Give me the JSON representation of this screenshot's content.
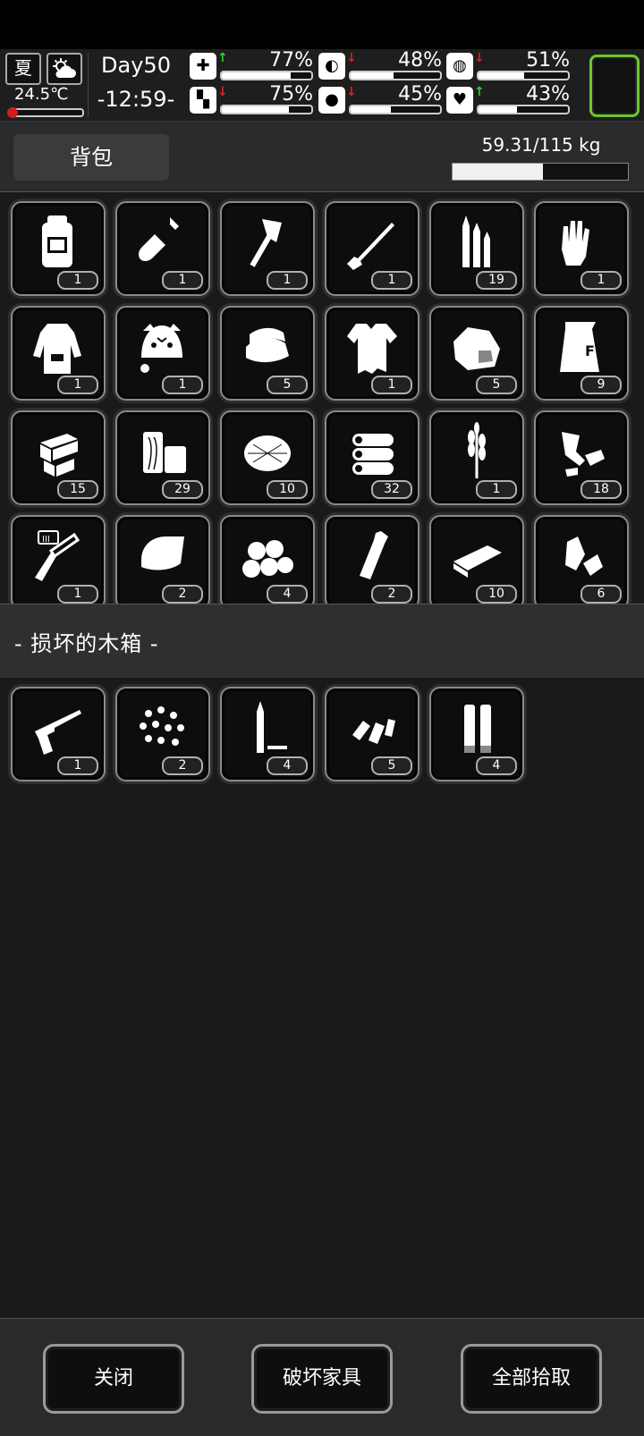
{
  "hud": {
    "season": "夏",
    "temperature": "24.5℃",
    "temperature_level": 0.05,
    "day": "Day50",
    "time": "-12:59-",
    "stats": [
      {
        "name": "health",
        "icon": "medkit-icon",
        "arrow": "up",
        "value": "77%",
        "level": 0.77
      },
      {
        "name": "hunger",
        "icon": "stomach-icon",
        "arrow": "down",
        "value": "48%",
        "level": 0.48
      },
      {
        "name": "mood",
        "icon": "mood-icon",
        "arrow": "down",
        "value": "51%",
        "level": 0.51
      },
      {
        "name": "stamina",
        "icon": "leg-icon",
        "arrow": "down",
        "value": "75%",
        "level": 0.75
      },
      {
        "name": "thirst",
        "icon": "water-drop-icon",
        "arrow": "down",
        "value": "45%",
        "level": 0.45
      },
      {
        "name": "heart",
        "icon": "heart-icon",
        "arrow": "up",
        "value": "43%",
        "level": 0.43
      }
    ]
  },
  "backpack": {
    "tab_label": "背包",
    "weight": "59.31/115 kg",
    "weight_level": 0.5157,
    "items": [
      {
        "icon": "backpack-icon",
        "count": "1"
      },
      {
        "icon": "shovel-icon",
        "count": "1"
      },
      {
        "icon": "axe-icon",
        "count": "1"
      },
      {
        "icon": "rifle-icon",
        "count": "1"
      },
      {
        "icon": "bullets-icon",
        "count": "19"
      },
      {
        "icon": "gloves-icon",
        "count": "1"
      },
      {
        "icon": "hoodie-icon",
        "count": "1"
      },
      {
        "icon": "tiger-hat-icon",
        "count": "1"
      },
      {
        "icon": "folded-cloth-icon",
        "count": "5"
      },
      {
        "icon": "torn-shirt-icon",
        "count": "1"
      },
      {
        "icon": "meat-icon",
        "count": "5"
      },
      {
        "icon": "flour-sack-icon",
        "count": "9"
      },
      {
        "icon": "planks-icon",
        "count": "15"
      },
      {
        "icon": "wood-blocks-icon",
        "count": "29"
      },
      {
        "icon": "fiber-bundle-icon",
        "count": "10"
      },
      {
        "icon": "logs-icon",
        "count": "32"
      },
      {
        "icon": "wheat-icon",
        "count": "1"
      },
      {
        "icon": "scrap-icon",
        "count": "18"
      },
      {
        "icon": "syringe-icon",
        "count": "1"
      },
      {
        "icon": "blanket-icon",
        "count": "2"
      },
      {
        "icon": "potatoes-icon",
        "count": "4"
      },
      {
        "icon": "bottle-icon",
        "count": "2"
      },
      {
        "icon": "bar-icon",
        "count": "10"
      },
      {
        "icon": "trash-icon",
        "count": "6"
      }
    ]
  },
  "crate": {
    "title": "- 损坏的木箱 -",
    "items": [
      {
        "icon": "revolver-icon",
        "count": "1"
      },
      {
        "icon": "shot-pellets-icon",
        "count": "2"
      },
      {
        "icon": "rifle-bullet-icon",
        "count": "4"
      },
      {
        "icon": "pistol-bullets-icon",
        "count": "5"
      },
      {
        "icon": "shotgun-shells-icon",
        "count": "4"
      }
    ]
  },
  "buttons": {
    "close": "关闭",
    "destroy": "破坏家具",
    "take_all": "全部拾取"
  },
  "colors": {
    "accent_green": "#6fc52d",
    "up_arrow": "#2bd12b",
    "down_arrow": "#e01f1f",
    "temperature": "#d21c1c"
  }
}
